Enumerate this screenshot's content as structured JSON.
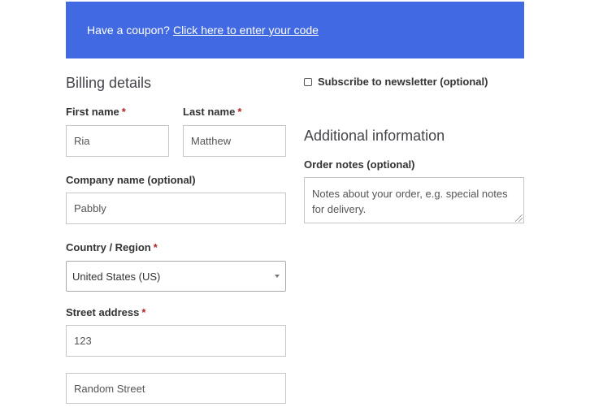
{
  "coupon": {
    "prompt": "Have a coupon?",
    "link_text": "Click here to enter your code",
    "background_color": "#4169e1"
  },
  "billing": {
    "title": "Billing details",
    "first_name": {
      "label": "First name",
      "required_mark": "*",
      "value": "Ria"
    },
    "last_name": {
      "label": "Last name",
      "required_mark": "*",
      "value": "Matthew"
    },
    "company": {
      "label": "Company name (optional)",
      "value": "Pabbly"
    },
    "country": {
      "label": "Country / Region",
      "required_mark": "*",
      "selected": "United States (US)"
    },
    "street": {
      "label": "Street address",
      "required_mark": "*",
      "line1_value": "123",
      "line2_value": "Random Street"
    }
  },
  "newsletter": {
    "label": "Subscribe to newsletter (optional)",
    "checked": false
  },
  "additional": {
    "title": "Additional information",
    "order_notes": {
      "label": "Order notes (optional)",
      "placeholder": "Notes about your order, e.g. special notes for delivery."
    }
  },
  "colors": {
    "required": "#b22222"
  }
}
